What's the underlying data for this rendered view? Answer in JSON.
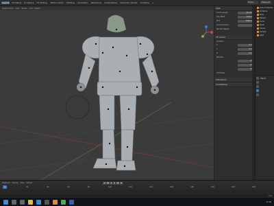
{
  "menu": [
    "Layout",
    "Modeling",
    "Sculpting",
    "UV Editing",
    "Texture Paint",
    "Shading",
    "Animation",
    "Rendering",
    "Compositing",
    "Geometry Nodes",
    "Scripting",
    "+"
  ],
  "menu_active_index": 0,
  "scene_label": "Scene",
  "view_layer_label": "ViewLayer",
  "viewport_header": [
    "Object Mode",
    "View",
    "Select",
    "Add",
    "Object"
  ],
  "npanel": {
    "section_view": "View",
    "focal_label": "Focal Length",
    "focal_value": "50 mm",
    "clip_start_label": "Clip Start",
    "clip_start_value": "0.01 m",
    "clip_end_label": "End",
    "clip_end_value": "1000 m",
    "local_camera_label": "Local Camera",
    "render_region_label": "Render Region",
    "section_3d_cursor": "3D Cursor",
    "location_label": "Location",
    "x_label": "X",
    "x_value": "0 m",
    "y_label": "Y",
    "y_value": "0 m",
    "z_label": "Z",
    "z_value": "0 m",
    "rotation_label": "Rotation",
    "rx_value": "0°",
    "ry_value": "0°",
    "rz_value": "0°",
    "mode_label": "XYZ Euler",
    "section_collections": "Collections",
    "section_annotations": "Annotations"
  },
  "outliner": [
    "Scene Collection",
    "Armature",
    "Body",
    "Helmet",
    "Armor",
    "Boots",
    "Gloves",
    "Camera",
    "Light"
  ],
  "properties_label": "Object",
  "timeline": {
    "labels": [
      "Playback",
      "Keying",
      "View",
      "Marker"
    ],
    "buttons": [
      "|◀",
      "◀◀",
      "◀",
      "▶",
      "▶▶",
      "▶|"
    ],
    "ticks": [
      "0",
      "20",
      "40",
      "60",
      "80",
      "100",
      "120",
      "140",
      "160",
      "180",
      "200",
      "220",
      "240"
    ],
    "current_frame": "1",
    "start": "1",
    "end": "250"
  },
  "status_text": "2.93",
  "taskbar": {
    "icons": [
      "windows-icon",
      "search-icon",
      "taskview-icon",
      "explorer-icon",
      "edge-icon",
      "store-icon",
      "blender-icon",
      "chrome-icon",
      "photoshop-icon"
    ],
    "clock": "17:02"
  },
  "colors": {
    "accent": "#4772b3",
    "model": "#a9aeb2"
  }
}
